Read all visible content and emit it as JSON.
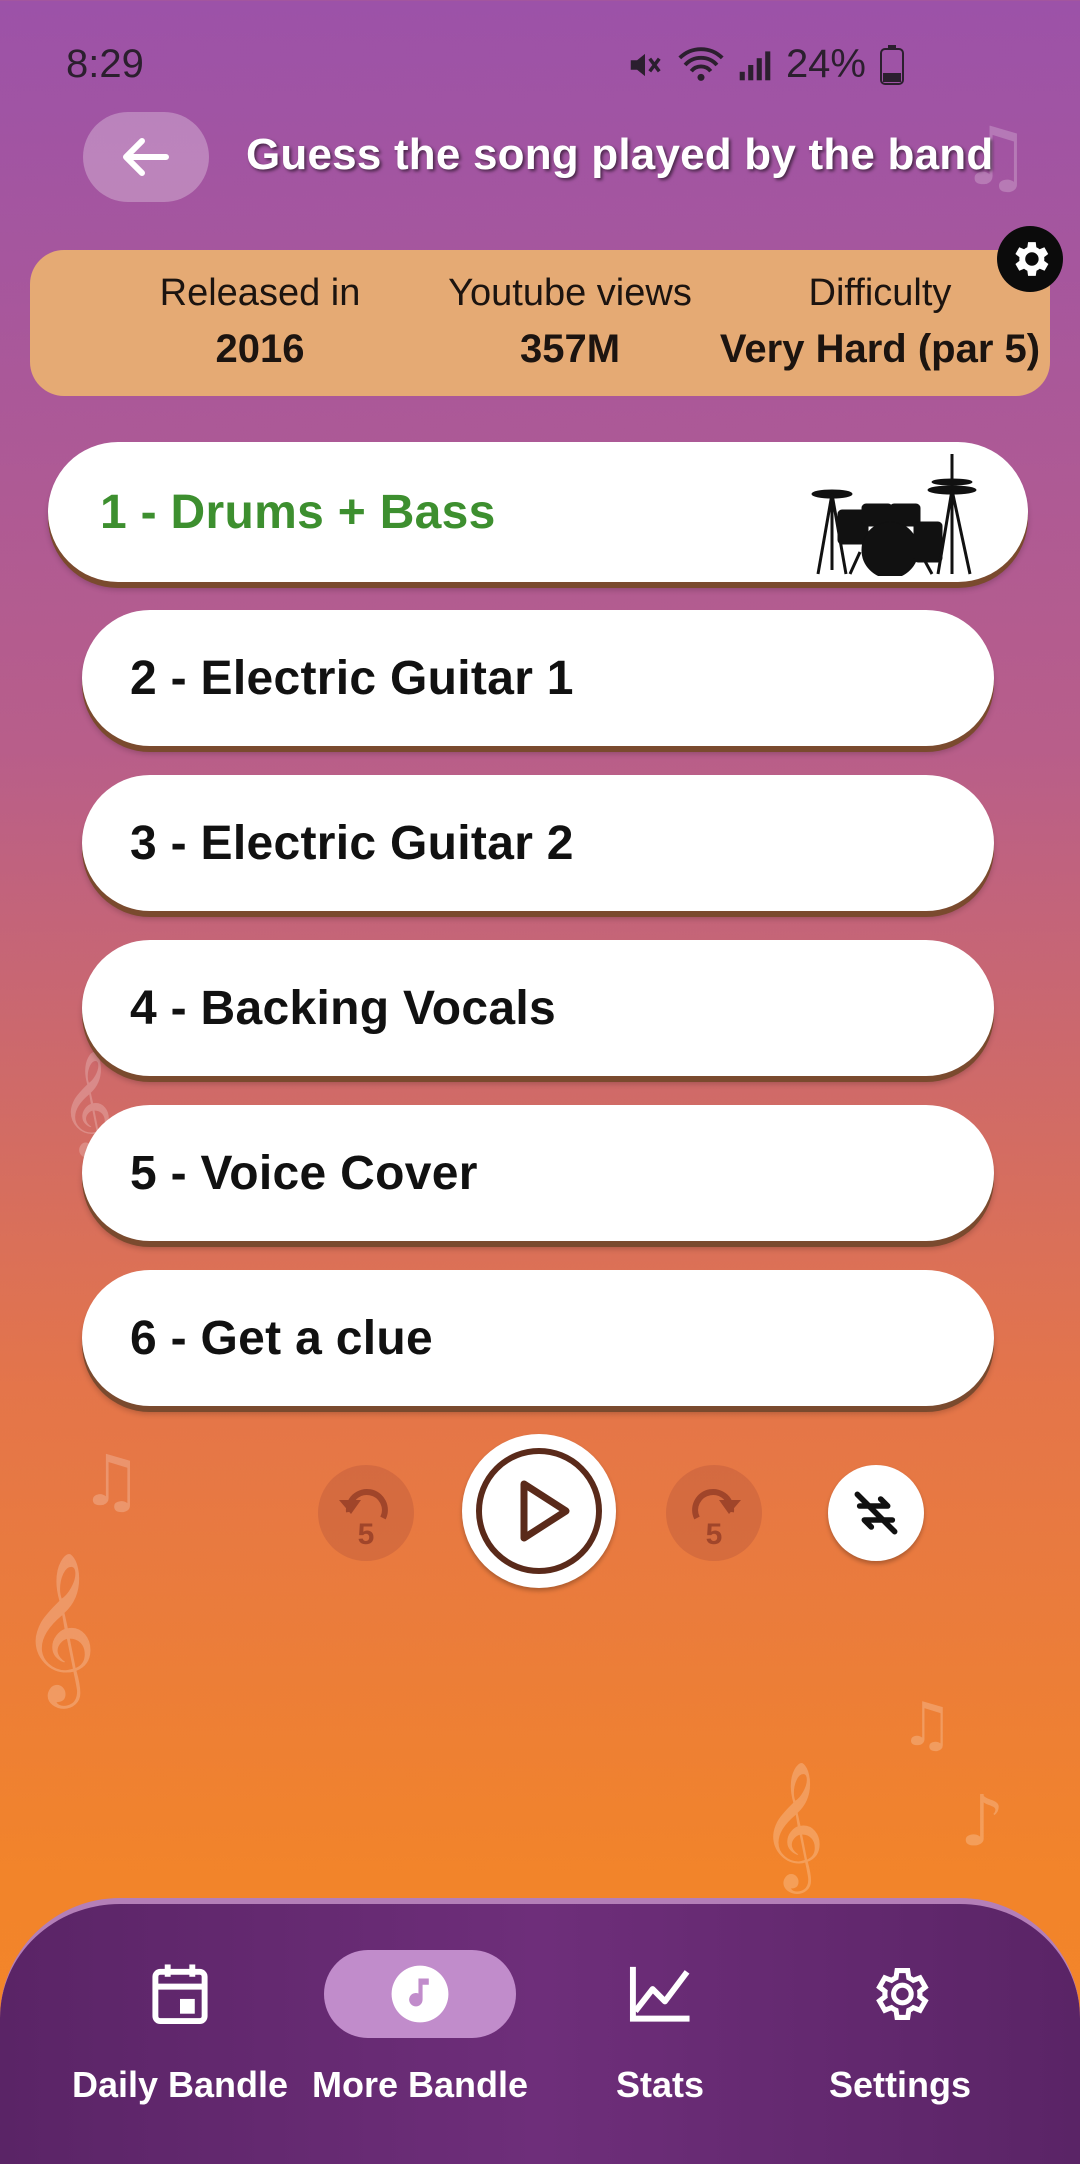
{
  "status_bar": {
    "time": "8:29",
    "battery": "24%"
  },
  "header": {
    "title": "Guess the song played by the band"
  },
  "info": {
    "released_label": "Released in",
    "released_value": "2016",
    "views_label": "Youtube views",
    "views_value": "357M",
    "difficulty_label": "Difficulty",
    "difficulty_value": "Very Hard (par 5)"
  },
  "stems": [
    {
      "label": "1 - Drums + Bass",
      "active": true
    },
    {
      "label": "2 - Electric Guitar 1"
    },
    {
      "label": "3 - Electric Guitar 2"
    },
    {
      "label": "4 - Backing Vocals"
    },
    {
      "label": "5 - Voice Cover"
    },
    {
      "label": "6 - Get a clue"
    }
  ],
  "player": {
    "rewind_seconds": "5",
    "forward_seconds": "5"
  },
  "bottom_nav": [
    {
      "label": "Daily Bandle",
      "icon": "calendar-icon"
    },
    {
      "label": "More Bandle",
      "icon": "music-note-icon",
      "selected": true
    },
    {
      "label": "Stats",
      "icon": "chart-icon"
    },
    {
      "label": "Settings",
      "icon": "gear-icon"
    }
  ],
  "colors": {
    "active_stem_text": "#3d8f2f",
    "info_card": "#e5aa74",
    "nav_bg": "#5a2466",
    "nav_pill": "#c18ccb"
  }
}
